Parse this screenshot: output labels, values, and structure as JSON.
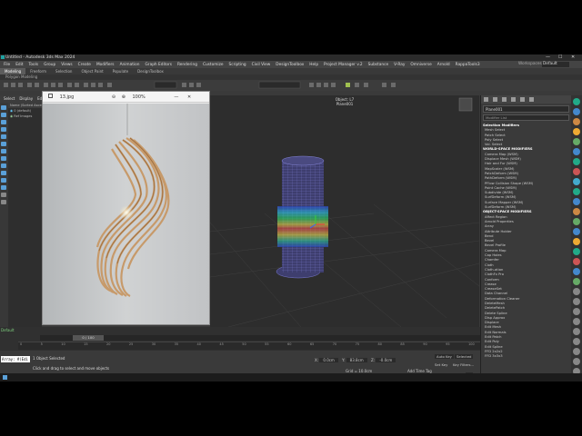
{
  "window": {
    "title": "Untitled - Autodesk 3ds Max 2024"
  },
  "menu": [
    "File",
    "Edit",
    "Tools",
    "Group",
    "Views",
    "Create",
    "Modifiers",
    "Animation",
    "Graph Editors",
    "Rendering",
    "Customize",
    "Scripting",
    "Civil View",
    "DesignToolbox",
    "Help",
    "Project Manager v.2",
    "Substance",
    "V-Ray",
    "Omniverse",
    "Arnold",
    "RappaTools3"
  ],
  "workspaces": {
    "label": "Workspaces:",
    "value": "Default"
  },
  "ribbon": {
    "tabs": [
      "Modeling",
      "Freeform",
      "Selection",
      "Object Paint",
      "Populate",
      "DesignToolbox"
    ],
    "active_tab": "Modeling",
    "subtitle": "Polygon Modeling"
  },
  "scene_explorer": {
    "tabs": [
      "Select",
      "Display",
      "Edit"
    ],
    "header": "Name (Sorted Ascending)",
    "items": [
      "0 (default)",
      "Ref Images"
    ]
  },
  "image_window": {
    "filename": "13.jpg",
    "zoom": "100%"
  },
  "viewport": {
    "label_line1": "Object: L7",
    "label_line2": "Plane001"
  },
  "command_panel": {
    "object_name": "Plane001",
    "modifier_list": "Modifier List",
    "items": [
      "Selection Modifiers",
      "Mesh Select",
      "Patch Select",
      "Poly Select",
      "Vol. Select",
      "WORLD-SPACE MODIFIERS",
      "Camera Map (WSM)",
      "Displace Mesh (WSM)",
      "Hair and Fur (WSM)",
      "MapScaler (WSM)",
      "PatchDeform (WSM)",
      "PathDeform (WSM)",
      "PFlow Collision Shape (WSM)",
      "Point Cache (WSM)",
      "Subdivide (WSM)",
      "SurfDeform (WSM)",
      "Surface Mapper (WSM)",
      "SurfDeform (WSM)",
      "OBJECT-SPACE MODIFIERS",
      "Affect Region",
      "Arnold Properties",
      "Array",
      "Attribute Holder",
      "Bend",
      "Bevel",
      "Bevel Profile",
      "Camera Map",
      "Cap Holes",
      "Chamfer",
      "Cloth",
      "Cloth-ation",
      "ClothFx Pro",
      "Conform",
      "Crease",
      "CreaseSet",
      "Data Channel",
      "Deformation Cleaner",
      "DeleteMesh",
      "DeletePatch",
      "Delete Spline",
      "Disp Approx",
      "Displace",
      "Edit Mesh",
      "Edit Normals",
      "Edit Patch",
      "Edit Poly",
      "Edit Spline",
      "FFD 2x2x2",
      "FFD 3x3x3"
    ]
  },
  "timeline": {
    "frame_label": "0 / 100",
    "ticks": [
      "0",
      "5",
      "10",
      "15",
      "20",
      "25",
      "30",
      "35",
      "40",
      "45",
      "50",
      "55",
      "60",
      "65",
      "70",
      "75",
      "80",
      "85",
      "90",
      "95",
      "100"
    ]
  },
  "layer_field": "Default",
  "status": {
    "maxscript": "Array: #(Edi",
    "line1": "1 Object Selected",
    "line2": "Click and drag to select and move objects",
    "coord_x_label": "X:",
    "coord_x": "0.0cm",
    "coord_y_label": "Y:",
    "coord_y": "83.8cm",
    "coord_z_label": "Z:",
    "coord_z": "-0.0cm",
    "grid": "Grid = 10.0cm",
    "add_time_tag": "Add Time Tag",
    "autokey": "Auto Key",
    "selected": "Selected",
    "set_key": "Set Key",
    "key_filters": "Key Filters...",
    "frame": "0"
  },
  "colors": {
    "viewport_bg": "#2d2d2d",
    "mesh_wire": "#5a5aa8",
    "accent": "#5aa0d8"
  }
}
